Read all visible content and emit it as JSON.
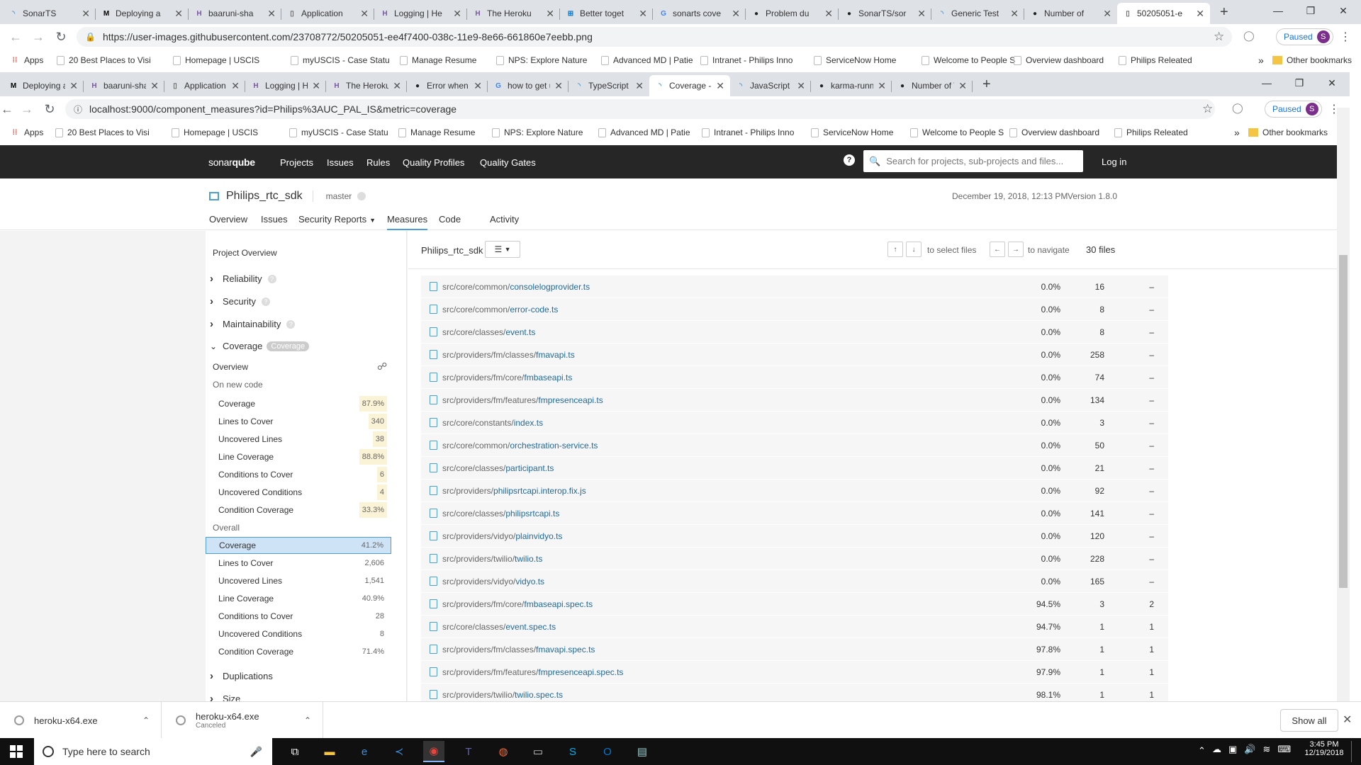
{
  "outer": {
    "tabs": [
      {
        "title": "SonarTS",
        "icon": "sonar-icon"
      },
      {
        "title": "Deploying a",
        "icon": "medium-icon"
      },
      {
        "title": "baaruni-sha",
        "icon": "heroku-icon"
      },
      {
        "title": "Application",
        "icon": "page-icon"
      },
      {
        "title": "Logging | He",
        "icon": "heroku-icon"
      },
      {
        "title": "The Heroku",
        "icon": "heroku-icon"
      },
      {
        "title": "Better toget",
        "icon": "vs-icon"
      },
      {
        "title": "sonarts cove",
        "icon": "google-icon"
      },
      {
        "title": "Problem du",
        "icon": "github-icon"
      },
      {
        "title": "SonarTS/sor",
        "icon": "github-icon"
      },
      {
        "title": "Generic Test",
        "icon": "sonar-icon"
      },
      {
        "title": "Number of",
        "icon": "github-icon"
      },
      {
        "title": "50205051-e",
        "icon": "page-icon"
      }
    ],
    "url": "https://user-images.githubusercontent.com/23708772/50205051-ee4f7400-038c-11e9-8e66-661860e7eebb.png",
    "paused_label": "Paused",
    "avatar_letter": "S",
    "bookmarks": [
      "Apps",
      "20 Best Places to Visi",
      "Homepage | USCIS",
      "myUSCIS - Case Statu",
      "Manage Resume",
      "NPS: Explore Nature",
      "Advanced MD | Patie",
      "Intranet - Philips Inno",
      "ServiceNow Home",
      "Welcome to People S",
      "Overview dashboard",
      "Philips Releated"
    ],
    "other_bookmarks": "Other bookmarks"
  },
  "inner": {
    "tabs": [
      {
        "title": "Deploying a V",
        "icon": "medium-icon"
      },
      {
        "title": "baaruni-sharm",
        "icon": "heroku-icon"
      },
      {
        "title": "Application Er",
        "icon": "page-icon"
      },
      {
        "title": "Logging | Her",
        "icon": "heroku-icon"
      },
      {
        "title": "The Heroku Cl",
        "icon": "heroku-icon"
      },
      {
        "title": "Error when pa",
        "icon": "github-icon"
      },
      {
        "title": "how to get un",
        "icon": "google-icon"
      },
      {
        "title": "TypeScript Tes",
        "icon": "sonar-icon"
      },
      {
        "title": "Coverage - Ph",
        "icon": "sonar-icon"
      },
      {
        "title": "JavaScript Cov",
        "icon": "sonar-icon"
      },
      {
        "title": "karma-runner",
        "icon": "github-icon"
      },
      {
        "title": "Number of Te",
        "icon": "github-icon"
      }
    ],
    "url": "localhost:9000/component_measures?id=Philips%3AUC_PAL_IS&metric=coverage",
    "paused_label": "Paused",
    "avatar_letter": "S",
    "bookmarks": [
      "Apps",
      "20 Best Places to Visi",
      "Homepage | USCIS",
      "myUSCIS - Case Statu",
      "Manage Resume",
      "NPS: Explore Nature",
      "Advanced MD | Patie",
      "Intranet - Philips Inno",
      "ServiceNow Home",
      "Welcome to People S",
      "Overview dashboard",
      "Philips Releated"
    ],
    "other_bookmarks": "Other bookmarks"
  },
  "sonar": {
    "logo_a": "sonar",
    "logo_b": "qube",
    "nav": [
      "Projects",
      "Issues",
      "Rules",
      "Quality Profiles",
      "Quality Gates"
    ],
    "search_placeholder": "Search for projects, sub-projects and files...",
    "login": "Log in",
    "project_name": "Philips_rtc_sdk",
    "branch": "master",
    "analysis_date": "December 19, 2018, 12:13 PM",
    "version": "Version 1.8.0",
    "project_nav": [
      "Overview",
      "Issues",
      "Security Reports",
      "Measures",
      "Code",
      "Activity"
    ]
  },
  "sidebar": {
    "heading": "Project Overview",
    "domains": [
      "Reliability",
      "Security",
      "Maintainability"
    ],
    "coverage_domain": "Coverage",
    "coverage_badge": "Coverage",
    "overview_link": "Overview",
    "new_code_label": "On new code",
    "new_code": [
      {
        "label": "Coverage",
        "value": "87.9%"
      },
      {
        "label": "Lines to Cover",
        "value": "340"
      },
      {
        "label": "Uncovered Lines",
        "value": "38"
      },
      {
        "label": "Line Coverage",
        "value": "88.8%"
      },
      {
        "label": "Conditions to Cover",
        "value": "6"
      },
      {
        "label": "Uncovered Conditions",
        "value": "4"
      },
      {
        "label": "Condition Coverage",
        "value": "33.3%"
      }
    ],
    "overall_label": "Overall",
    "overall": [
      {
        "label": "Coverage",
        "value": "41.2%"
      },
      {
        "label": "Lines to Cover",
        "value": "2,606"
      },
      {
        "label": "Uncovered Lines",
        "value": "1,541"
      },
      {
        "label": "Line Coverage",
        "value": "40.9%"
      },
      {
        "label": "Conditions to Cover",
        "value": "28"
      },
      {
        "label": "Uncovered Conditions",
        "value": "8"
      },
      {
        "label": "Condition Coverage",
        "value": "71.4%"
      }
    ],
    "more_domains": [
      "Duplications",
      "Size"
    ]
  },
  "main": {
    "breadcrumb": "Philips_rtc_sdk",
    "select_hint": "to select files",
    "navigate_hint": "to navigate",
    "file_count": "30 files",
    "files": [
      {
        "dir": "src/core/common/",
        "name": "consolelogprovider.ts",
        "cov": "0.0%",
        "lines": "16",
        "cond": "–"
      },
      {
        "dir": "src/core/common/",
        "name": "error-code.ts",
        "cov": "0.0%",
        "lines": "8",
        "cond": "–"
      },
      {
        "dir": "src/core/classes/",
        "name": "event.ts",
        "cov": "0.0%",
        "lines": "8",
        "cond": "–"
      },
      {
        "dir": "src/providers/fm/classes/",
        "name": "fmavapi.ts",
        "cov": "0.0%",
        "lines": "258",
        "cond": "–"
      },
      {
        "dir": "src/providers/fm/core/",
        "name": "fmbaseapi.ts",
        "cov": "0.0%",
        "lines": "74",
        "cond": "–"
      },
      {
        "dir": "src/providers/fm/features/",
        "name": "fmpresenceapi.ts",
        "cov": "0.0%",
        "lines": "134",
        "cond": "–"
      },
      {
        "dir": "src/core/constants/",
        "name": "index.ts",
        "cov": "0.0%",
        "lines": "3",
        "cond": "–"
      },
      {
        "dir": "src/core/common/",
        "name": "orchestration-service.ts",
        "cov": "0.0%",
        "lines": "50",
        "cond": "–"
      },
      {
        "dir": "src/core/classes/",
        "name": "participant.ts",
        "cov": "0.0%",
        "lines": "21",
        "cond": "–"
      },
      {
        "dir": "src/providers/",
        "name": "philipsrtcapi.interop.fix.js",
        "cov": "0.0%",
        "lines": "92",
        "cond": "–"
      },
      {
        "dir": "src/core/classes/",
        "name": "philipsrtcapi.ts",
        "cov": "0.0%",
        "lines": "141",
        "cond": "–"
      },
      {
        "dir": "src/providers/vidyo/",
        "name": "plainvidyo.ts",
        "cov": "0.0%",
        "lines": "120",
        "cond": "–"
      },
      {
        "dir": "src/providers/twilio/",
        "name": "twilio.ts",
        "cov": "0.0%",
        "lines": "228",
        "cond": "–"
      },
      {
        "dir": "src/providers/vidyo/",
        "name": "vidyo.ts",
        "cov": "0.0%",
        "lines": "165",
        "cond": "–"
      },
      {
        "dir": "src/providers/fm/core/",
        "name": "fmbaseapi.spec.ts",
        "cov": "94.5%",
        "lines": "3",
        "cond": "2"
      },
      {
        "dir": "src/core/classes/",
        "name": "event.spec.ts",
        "cov": "94.7%",
        "lines": "1",
        "cond": "1"
      },
      {
        "dir": "src/providers/fm/classes/",
        "name": "fmavapi.spec.ts",
        "cov": "97.8%",
        "lines": "1",
        "cond": "1"
      },
      {
        "dir": "src/providers/fm/features/",
        "name": "fmpresenceapi.spec.ts",
        "cov": "97.9%",
        "lines": "1",
        "cond": "1"
      },
      {
        "dir": "src/providers/twilio/",
        "name": "twilio.spec.ts",
        "cov": "98.1%",
        "lines": "1",
        "cond": "1"
      }
    ]
  },
  "downloads": [
    {
      "name": "heroku-x64.exe",
      "status": ""
    },
    {
      "name": "heroku-x64.exe",
      "status": "Canceled"
    }
  ],
  "show_all": "Show all",
  "taskbar": {
    "search_placeholder": "Type here to search",
    "time": "3:45 PM",
    "date": "12/19/2018"
  }
}
